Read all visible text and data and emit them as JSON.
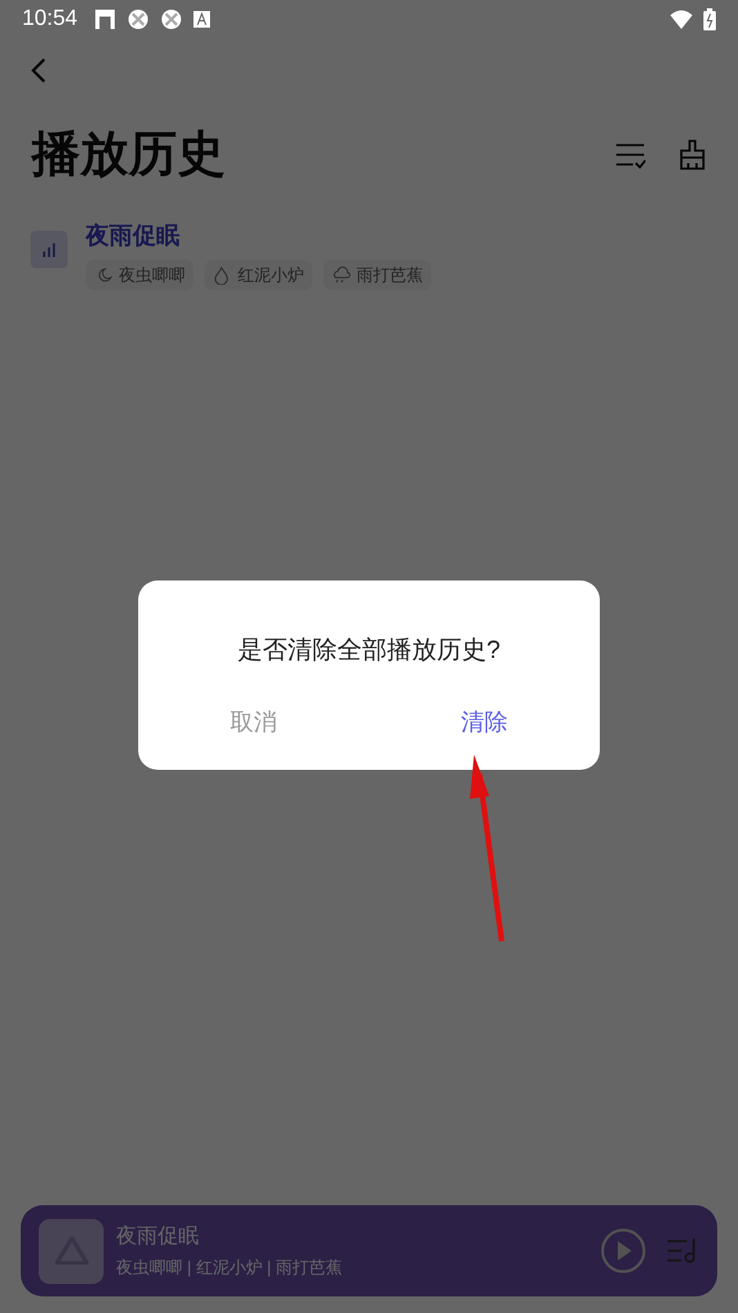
{
  "status_bar": {
    "time": "10:54"
  },
  "page": {
    "title": "播放历史"
  },
  "history": [
    {
      "title": "夜雨促眠",
      "tags": [
        "夜虫唧唧",
        "红泥小炉",
        "雨打芭蕉"
      ]
    }
  ],
  "player": {
    "title": "夜雨促眠",
    "subtitle": "夜虫唧唧 | 红泥小炉 | 雨打芭蕉"
  },
  "dialog": {
    "message": "是否清除全部播放历史?",
    "buttons": [
      {
        "label": "取消",
        "kind": "cancel"
      },
      {
        "label": "清除",
        "kind": "confirm"
      }
    ]
  }
}
